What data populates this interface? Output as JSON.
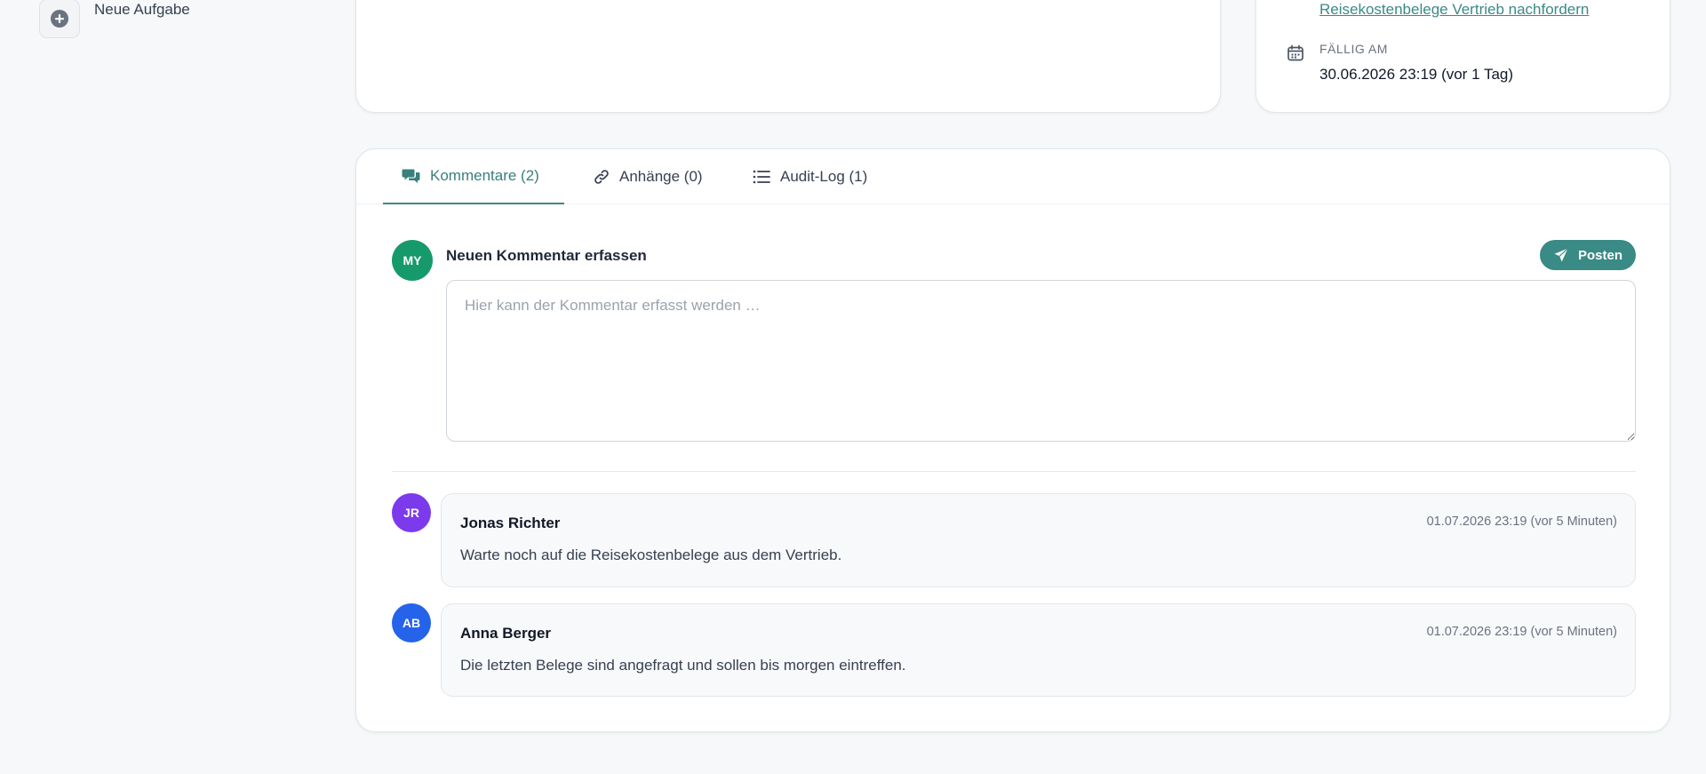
{
  "sidebar": {
    "new_task_label": "Neue Aufgabe"
  },
  "details": {
    "related_task_link": "Reisekostenbelege Vertrieb nachfordern",
    "due_label": "FÄLLIG AM",
    "due_value": "30.06.2026 23:19 (vor 1 Tag)"
  },
  "tabs": [
    {
      "label": "Kommentare (2)",
      "icon": "comments-icon",
      "active": true
    },
    {
      "label": "Anhänge (0)",
      "icon": "link-icon",
      "active": false
    },
    {
      "label": "Audit-Log (1)",
      "icon": "list-icon",
      "active": false
    }
  ],
  "new_comment": {
    "avatar_initials": "MY",
    "title": "Neuen Kommentar erfassen",
    "post_label": "Posten",
    "placeholder": "Hier kann der Kommentar erfasst werden …",
    "value": ""
  },
  "comments": [
    {
      "initials": "JR",
      "author": "Jonas Richter",
      "timestamp": "01.07.2026 23:19 (vor 5 Minuten)",
      "text": "Warte noch auf die Reisekostenbelege aus dem Vertrieb."
    },
    {
      "initials": "AB",
      "author": "Anna Berger",
      "timestamp": "01.07.2026 23:19 (vor 5 Minuten)",
      "text": "Die letzten Belege sind angefragt und sollen bis morgen eintreffen."
    }
  ],
  "colors": {
    "accent": "#3a8a86",
    "avatar_me": "#169a6b",
    "avatar_jr": "#7c3aed",
    "avatar_ab": "#2563eb"
  }
}
